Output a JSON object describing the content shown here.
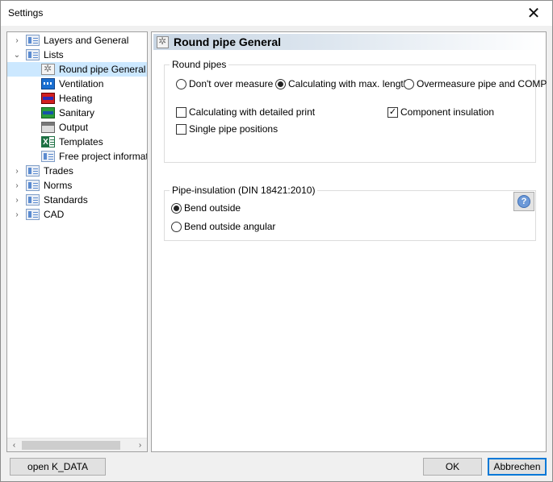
{
  "window": {
    "title": "Settings",
    "close_symbol": "✕"
  },
  "tree": {
    "items": [
      {
        "label": "Layers and General",
        "icon": "folder-doc-icon",
        "expander": "›",
        "level": 0
      },
      {
        "label": "Lists",
        "icon": "folder-doc-icon",
        "expander": "⌄",
        "level": 0
      },
      {
        "label": "Round pipe General",
        "icon": "gear-icon",
        "level": 1,
        "selected": true
      },
      {
        "label": "Ventilation",
        "icon": "ventilation-icon",
        "level": 1
      },
      {
        "label": "Heating",
        "icon": "heating-icon",
        "level": 1
      },
      {
        "label": "Sanitary",
        "icon": "sanitary-icon",
        "level": 1
      },
      {
        "label": "Output",
        "icon": "output-icon",
        "level": 1
      },
      {
        "label": "Templates",
        "icon": "excel-icon",
        "level": 1
      },
      {
        "label": "Free project informat",
        "icon": "folder-doc-icon",
        "level": 1
      },
      {
        "label": "Trades",
        "icon": "folder-doc-icon",
        "expander": "›",
        "level": 0
      },
      {
        "label": "Norms",
        "icon": "folder-doc-icon",
        "expander": "›",
        "level": 0
      },
      {
        "label": "Standards",
        "icon": "folder-doc-icon",
        "expander": "›",
        "level": 0
      },
      {
        "label": "CAD",
        "icon": "folder-doc-icon",
        "expander": "›",
        "level": 0
      }
    ],
    "scroll_left": "‹",
    "scroll_right": "›"
  },
  "content": {
    "header_title": "Round pipe General",
    "round_pipes": {
      "legend": "Round pipes",
      "radios": [
        {
          "label": "Don't over measure",
          "checked": false
        },
        {
          "label": "Calculating with max. length",
          "checked": true
        },
        {
          "label": "Overmeasure pipe and COMP",
          "checked": false
        }
      ],
      "checkboxes": [
        {
          "label": "Calculating with detailed print",
          "checked": false
        },
        {
          "label": "Component insulation",
          "checked": true
        },
        {
          "label": "Single pipe positions",
          "checked": false
        }
      ]
    },
    "insulation": {
      "legend": "Pipe-insulation (DIN 18421:2010)",
      "radios": [
        {
          "label": "Bend outside",
          "checked": true
        },
        {
          "label": "Bend outside angular",
          "checked": false
        }
      ],
      "help_symbol": "?"
    }
  },
  "footer": {
    "open_kdata_label": "open K_DATA",
    "ok_label": "OK",
    "cancel_label": "Abbrechen"
  },
  "colors": {
    "selection": "#cce8ff",
    "default_button_border": "#0078d7"
  }
}
